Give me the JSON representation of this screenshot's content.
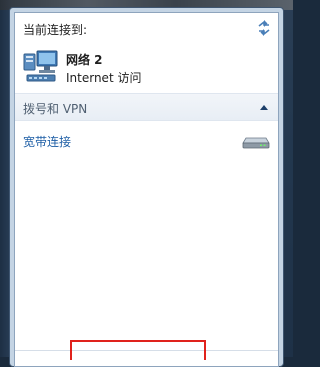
{
  "header": {
    "label": "当前连接到:"
  },
  "network": {
    "name": "网络  2",
    "access": "Internet 访问"
  },
  "section": {
    "label": "拨号和 VPN"
  },
  "connections": [
    {
      "label": "宽带连接"
    }
  ],
  "icons": {
    "refresh": "refresh-arrows-icon",
    "network": "network-computer-icon",
    "collapse": "chevron-up-icon",
    "modem": "dialup-modem-icon"
  },
  "colors": {
    "link": "#1f5fa6",
    "highlight_box": "#e0221c"
  }
}
